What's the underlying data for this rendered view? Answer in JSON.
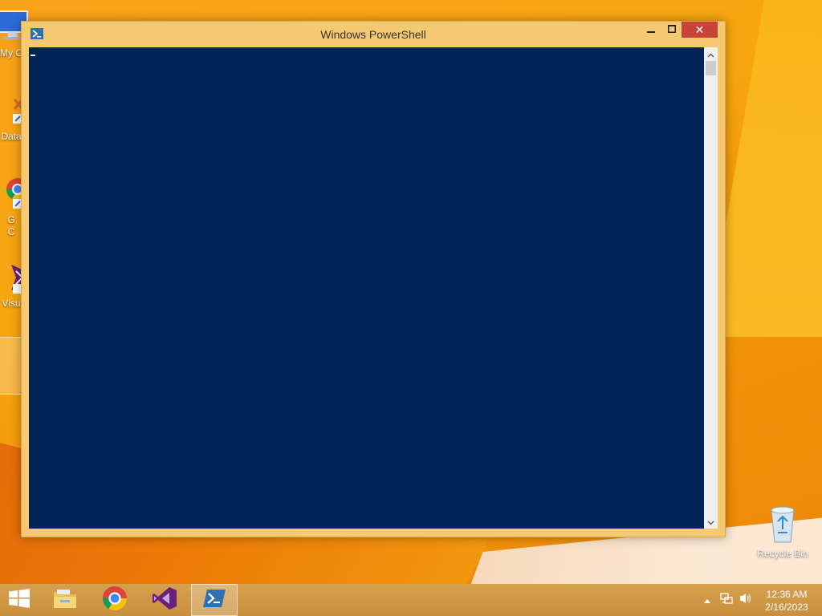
{
  "window": {
    "title": "Windows PowerShell",
    "close_glyph": "✕"
  },
  "desktop_icons": [
    {
      "label": "My C",
      "icon": "my-computer-icon"
    },
    {
      "label": "Data",
      "icon": "data-shortcut-icon"
    },
    {
      "label": "G",
      "label_line2": "C",
      "icon": "google-chrome-shortcut-icon"
    },
    {
      "label": "Visu",
      "icon": "visual-studio-shortcut-icon"
    },
    {
      "label": "Recycle Bin",
      "icon": "recycle-bin-icon"
    }
  ],
  "taskbar": {
    "pinned": [
      "start",
      "file-explorer",
      "chrome",
      "visual-studio",
      "powershell"
    ],
    "active": "powershell"
  },
  "tray": {
    "time": "12:36 AM",
    "date": "2/16/2023"
  },
  "colors": {
    "console_background": "#012456",
    "close_button": "#c7443a",
    "window_frame": "#f5c972"
  }
}
